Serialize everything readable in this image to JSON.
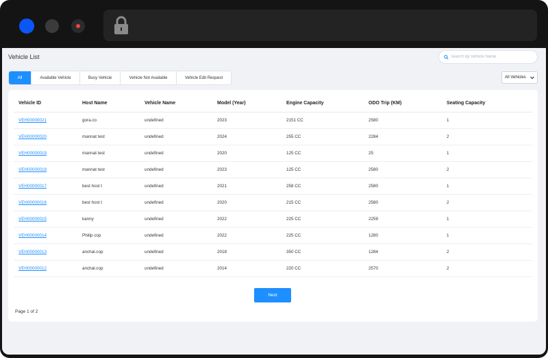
{
  "page": {
    "title": "Vehicle List",
    "search_placeholder": "Search By Vehicle Name",
    "tabs": [
      {
        "label": "All",
        "active": true
      },
      {
        "label": "Available Vehicle",
        "active": false
      },
      {
        "label": "Busy Vehicle",
        "active": false
      },
      {
        "label": "Vehicle Not Available",
        "active": false
      },
      {
        "label": "Vehicle Edit Request",
        "active": false
      }
    ],
    "filter_value": "All Vehicles",
    "next_label": "Next",
    "page_info": "Page 1 of 2"
  },
  "table": {
    "columns": [
      "Vehicle ID",
      "Host Name",
      "Vehicle Name",
      "Model (Year)",
      "Engine Capacity",
      "ODO Trip (KM)",
      "Seating Capacity"
    ],
    "rows": [
      [
        "VEH00000021",
        "gora.co",
        "undefined",
        "2023",
        "2151 CC",
        "2580",
        "1"
      ],
      [
        "VEH00000020",
        "mannat test",
        "undefined",
        "2024",
        "255 CC",
        "2284",
        "2"
      ],
      [
        "VEH00000019",
        "mannat test",
        "undefined",
        "2020",
        "125 CC",
        "25",
        "1"
      ],
      [
        "VEH00000018",
        "mannat test",
        "undefined",
        "2023",
        "125 CC",
        "2580",
        "2"
      ],
      [
        "VEH00000017",
        "best host t",
        "undefined",
        "2021",
        "258 CC",
        "2580",
        "1"
      ],
      [
        "VEH00000016",
        "best host t",
        "undefined",
        "2020",
        "215 CC",
        "2580",
        "2"
      ],
      [
        "VEH00000015",
        "kanny",
        "undefined",
        "2022",
        "225 CC",
        "2259",
        "1"
      ],
      [
        "VEH00000014",
        "Philip cop",
        "undefined",
        "2022",
        "225 CC",
        "1280",
        "1"
      ],
      [
        "VEH00000013",
        "anchal.cop",
        "undefined",
        "2018",
        "350 CC",
        "1284",
        "2"
      ],
      [
        "VEH00000012",
        "anchal.cop",
        "undefined",
        "2014",
        "220 CC",
        "2570",
        "2"
      ]
    ]
  },
  "colors": {
    "accent": "#1e8fff",
    "window_dot_blue": "#0b57f5",
    "record_dot": "#e04848"
  },
  "icons": [
    "lock-icon",
    "search-icon",
    "chevron-down-icon"
  ]
}
